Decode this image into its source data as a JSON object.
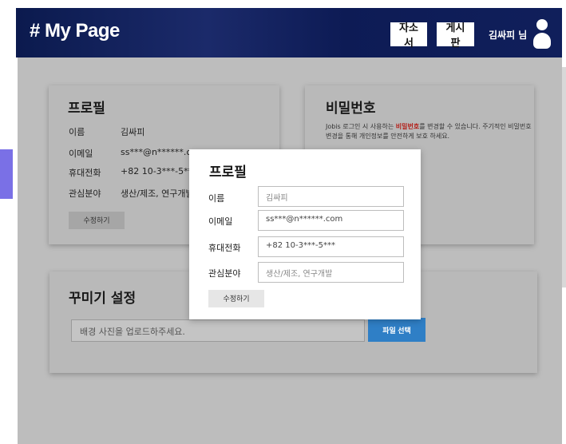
{
  "header": {
    "title": "# My Page",
    "resume_button": "자소서",
    "board_button": "게시판",
    "user_name": "김싸피 님"
  },
  "profile_card": {
    "title": "프로필",
    "fields": [
      {
        "label": "이름",
        "value": "김싸피"
      },
      {
        "label": "이메일",
        "value": "ss***@n******.co"
      },
      {
        "label": "휴대전화",
        "value": "+82 10-3***-5***"
      },
      {
        "label": "관심분야",
        "value": "생산/제조, 연구개발"
      }
    ],
    "edit_button": "수정하기"
  },
  "password_card": {
    "title": "비밀번호",
    "desc_part1": "Jobis 로그인 시 사용하는 ",
    "desc_highlight": "비밀번호",
    "desc_part2": "를 변경할 수 있습니다. 주기적인 비밀번호 변경을 통해 개인정보를 안전하게 보호 하세요."
  },
  "deco_card": {
    "title": "꾸미기 설정",
    "upload_placeholder": "배경 사진을 업로드하주세요.",
    "file_button": "파일 선택"
  },
  "modal": {
    "title": "프로필",
    "fields": [
      {
        "label": "이름",
        "value": "김싸피"
      },
      {
        "label": "이메일",
        "value": "ss***@n******.com"
      },
      {
        "label": "휴대전화",
        "value": "+82 10-3***-5***"
      },
      {
        "label": "관심분야",
        "value": "생산/제조, 연구개발"
      }
    ],
    "edit_button": "수정하기"
  },
  "colors": {
    "header_bg": "#0b1a4e",
    "page_bg": "#bdbdbd",
    "accent_left": "#7a70e6",
    "file_button": "#2f7fc6",
    "highlight": "#b3201a"
  }
}
